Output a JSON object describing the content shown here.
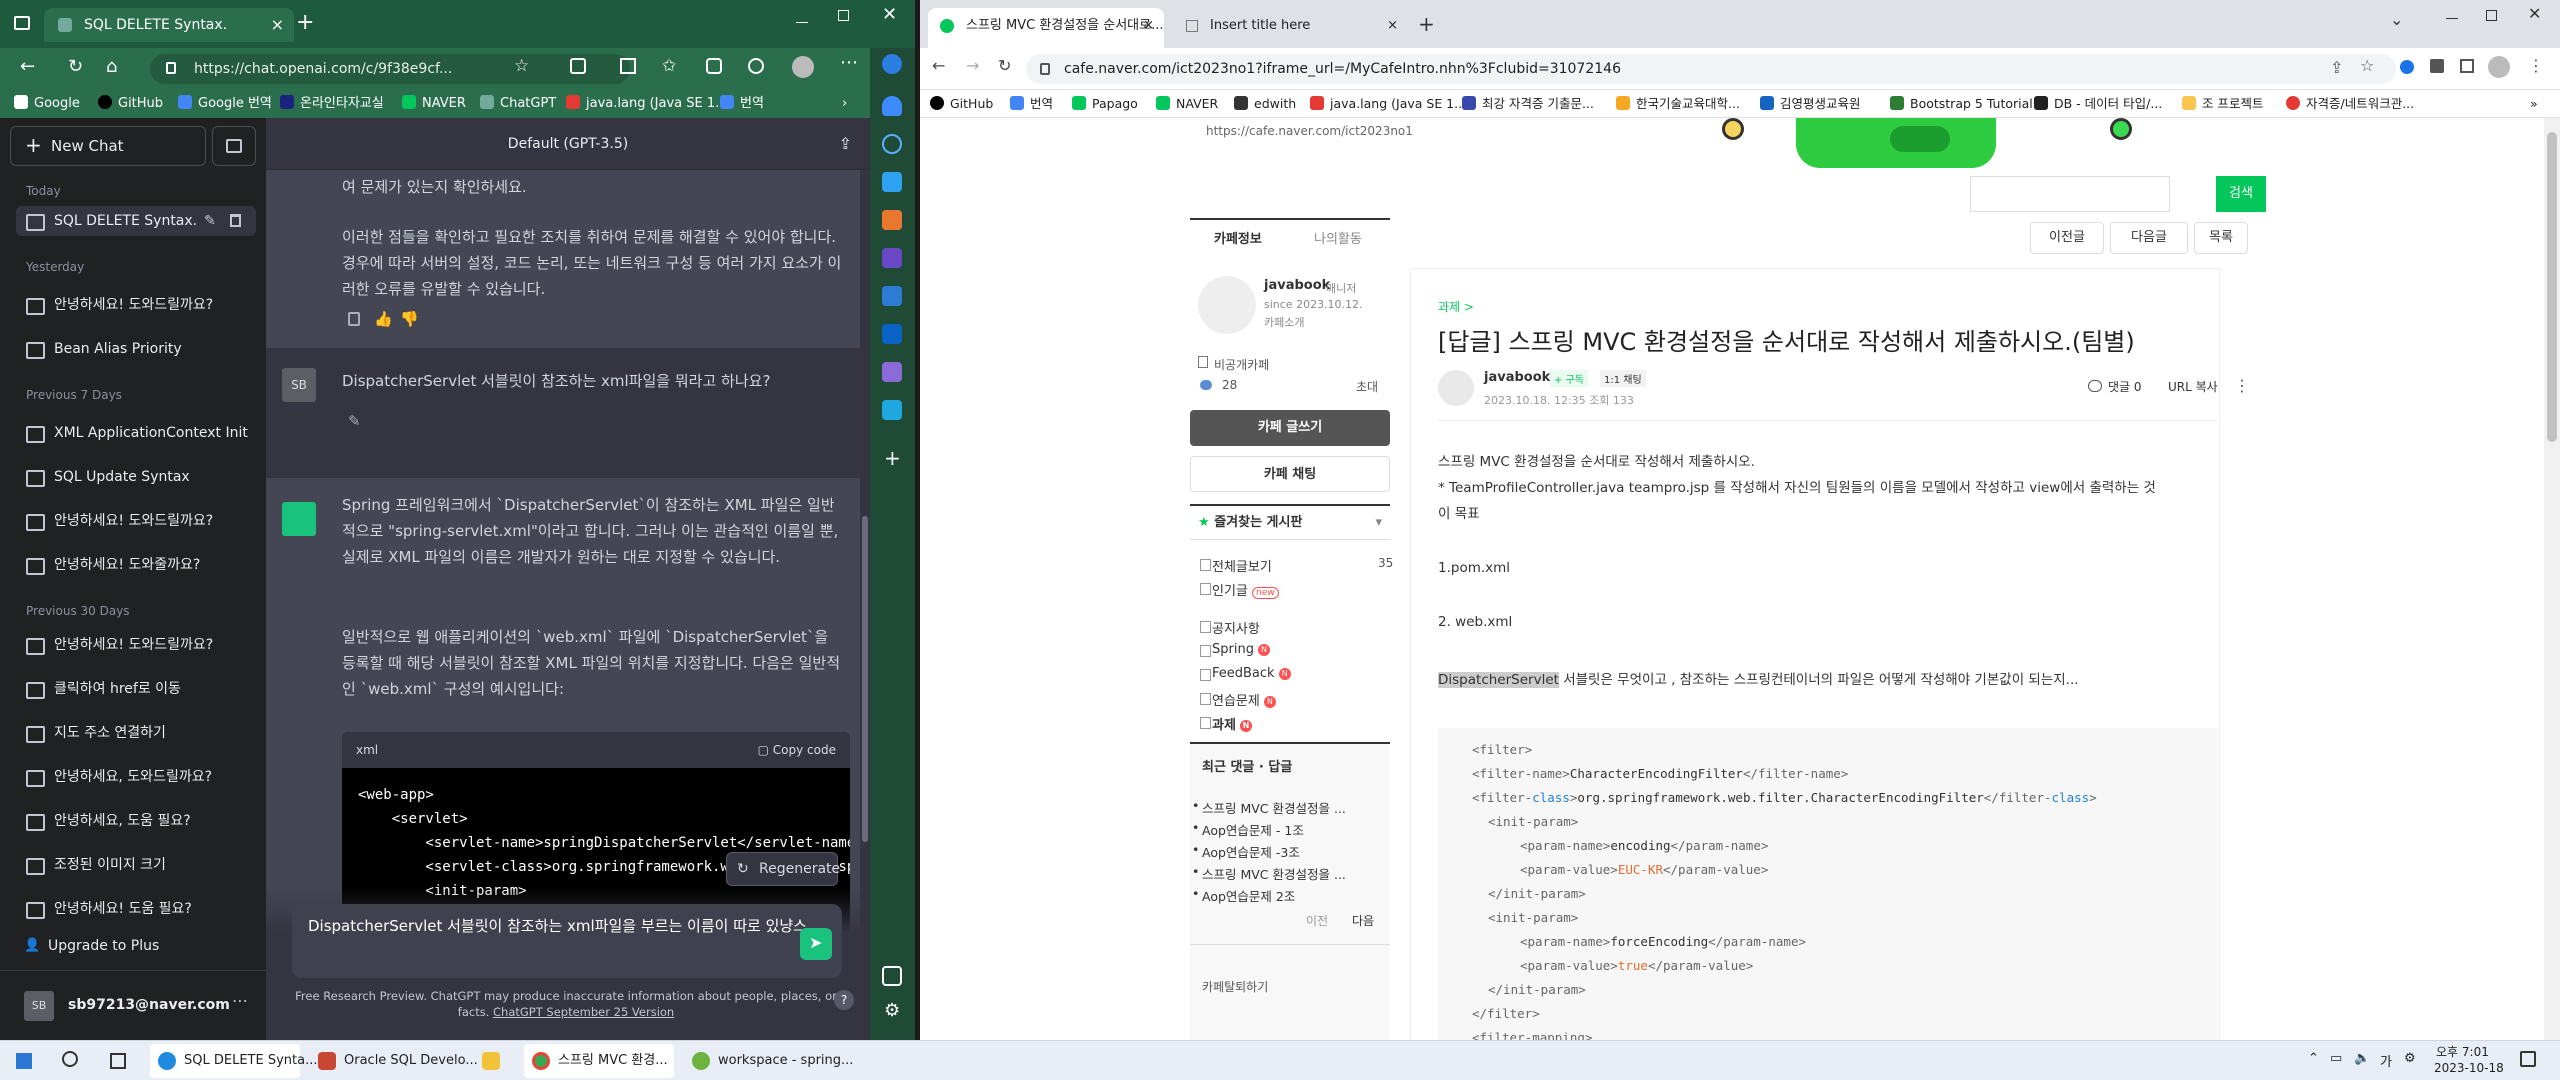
{
  "edge": {
    "tab_title": "SQL DELETE Syntax.",
    "url": "https://chat.openai.com/c/9f38e9cf...",
    "bookmarks": [
      "Google",
      "GitHub",
      "Google 번역",
      "온라인타자교실",
      "NAVER",
      "ChatGPT",
      "java.lang (Java SE 1...",
      "번역"
    ]
  },
  "chatgpt": {
    "new_chat": "New Chat",
    "model": "Default (GPT-3.5)",
    "groups": [
      {
        "label": "Today",
        "items": [
          "SQL DELETE Syntax."
        ]
      },
      {
        "label": "Yesterday",
        "items": [
          "안녕하세요! 도와드릴까요?",
          "Bean Alias Priority"
        ]
      },
      {
        "label": "Previous 7 Days",
        "items": [
          "XML ApplicationContext Initi",
          "SQL Update Syntax",
          "안녕하세요! 도와드릴까요?",
          "안녕하세요! 도와줄까요?"
        ]
      },
      {
        "label": "Previous 30 Days",
        "items": [
          "안녕하세요! 도와드릴까요?",
          "클릭하여 href로 이동",
          "지도 주소 연결하기",
          "안녕하세요, 도와드릴까요?",
          "안녕하세요, 도움 필요?",
          "조정된 이미지 크기",
          "안녕하세요! 도움 필요?"
        ]
      }
    ],
    "upgrade": "Upgrade to Plus",
    "account": "sb97213@naver.com",
    "avatar_initials": "SB",
    "prev_text_1": "여 문제가 있는지 확인하세요.",
    "prev_text_2": "이러한 점들을 확인하고 필요한 조치를 취하여 문제를 해결할 수 있어야 합니다. 경우에 따라 서버의 설정, 코드 논리, 또는 네트워크 구성 등 여러 가지 요소가 이러한 오류를 유발할 수 있습니다.",
    "user_question": "DispatcherServlet 서블릿이 참조하는 xml파일을 뭐라고 하나요?",
    "answer_p1": "Spring 프레임워크에서 `DispatcherServlet`이 참조하는 XML 파일은 일반적으로 \"spring-servlet.xml\"이라고 합니다. 그러나 이는 관습적인 이름일 뿐, 실제로 XML 파일의 이름은 개발자가 원하는 대로 지정할 수 있습니다.",
    "answer_p2": "일반적으로 웹 애플리케이션의 `web.xml` 파일에 `DispatcherServlet`을 등록할 때 해당 서블릿이 참조할 XML 파일의 위치를 지정합니다. 다음은 일반적인 `web.xml` 구성의 예시입니다:",
    "code_lang": "xml",
    "copy_code": "Copy code",
    "code_lines": [
      "<web-app>",
      "    <servlet>",
      "        <servlet-name>springDispatcherServlet</servlet-name>",
      "        <servlet-class>org.springframework.web.servlet.DispatcherServlet</servlet-class>",
      "        <init-param>"
    ],
    "regenerate": "Regenerate",
    "input_text": "DispatcherServlet 서블릿이 참조하는 xml파일을 부르는 이름이 따로 있냥스",
    "footer": "Free Research Preview. ChatGPT may produce inaccurate information about people, places, or facts.",
    "footer_link": "ChatGPT September 25 Version"
  },
  "chrome": {
    "tabs": [
      "스프링 MVC 환경설정을 순서대로...",
      "Insert title here"
    ],
    "url": "cafe.naver.com/ict2023no1?iframe_url=/MyCafeIntro.nhn%3Fclubid=31072146",
    "bookmarks": [
      "GitHub",
      "번역",
      "Papago",
      "NAVER",
      "edwith",
      "java.lang (Java SE 1...",
      "최강 자격증 기출문...",
      "한국기술교육대학...",
      "김영평생교육원",
      "Bootstrap 5 Tutorial",
      "DB - 데이터 타입/...",
      "조 프로젝트",
      "자격증/네트워크관..."
    ]
  },
  "cafe": {
    "banner_url": "https://cafe.naver.com/ict2023no1",
    "search_btn": "검색",
    "nav_prev": "이전글",
    "nav_next": "다음글",
    "nav_list": "목록",
    "tab_info": "카페정보",
    "tab_activity": "나의활동",
    "cafe_name": "javabook",
    "manager": "매니저",
    "since": "since 2023.10.12.",
    "intro": "카페소개",
    "privacy": "비공개카페",
    "members": "28",
    "invite": "초대",
    "write_btn": "카페 글쓰기",
    "chat_btn": "카페 채팅",
    "fav_boards": "즐겨찾는 게시판",
    "boards": [
      {
        "name": "전체글보기",
        "count": "35"
      },
      {
        "name": "인기글",
        "badge": "new"
      },
      {
        "name": "공지사항"
      },
      {
        "name": "Spring",
        "badge": "N"
      },
      {
        "name": "FeedBack",
        "badge": "N"
      },
      {
        "name": "연습문제",
        "badge": "N"
      },
      {
        "name": "과제",
        "badge": "N"
      }
    ],
    "recent_title": "최근 댓글 · 답글",
    "recent": [
      "스프링 MVC 환경설정을 ...",
      "Aop연습문제 - 1조",
      "Aop연습문제 -3조",
      "스프링 MVC 환경설정을 ...",
      "Aop연습문제 2조"
    ],
    "pager_prev": "이전",
    "pager_next": "다음",
    "leave": "카페탈퇴하기",
    "category": "과제 >",
    "title": "[답글] 스프링 MVC 환경설정을 순서대로 작성해서 제출하시오.(팀별)",
    "author": "javabook",
    "follow": "+ 구독",
    "chat": "1:1 채팅",
    "meta": "2023.10.18. 12:35  조회 133",
    "comments": "댓글 0",
    "copy_url": "URL 복사",
    "body1": "스프링 MVC 환경설정을 순서대로 작성해서 제출하시오.",
    "body2": "* TeamProfileController.java teampro.jsp 를 작성해서 자신의 팀원들의 이름을 모델에서 작성하고 view에서 출력하는 것",
    "body3": "이 목표",
    "body4": "1.pom.xml",
    "body5": "2. web.xml",
    "body6_hl": "DispatcherServlet",
    "body6": " 서블릿은 무엇이고 , 참조하는 스프링컨테이너의 파일은 어떻게 작성해야 기본값이 되는지..."
  },
  "taskbar": {
    "items": [
      "SQL DELETE Synta...",
      "Oracle SQL Develo...",
      "스프링 MVC 환경...",
      "workspace - spring..."
    ],
    "time": "오후 7:01",
    "date": "2023-10-18",
    "ime": "가"
  }
}
